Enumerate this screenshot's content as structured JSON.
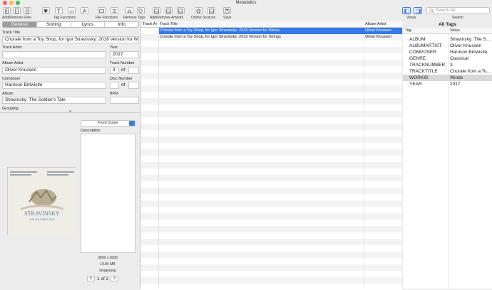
{
  "window": {
    "title": "Metadatics"
  },
  "toolbar": {
    "groups": [
      {
        "label": "Add/Remove Files"
      },
      {
        "label": "Tag Functions"
      },
      {
        "label": "File Functions"
      },
      {
        "label": "Remove Tags"
      },
      {
        "label": "Add/Remove Artwork"
      },
      {
        "label": "Online Sources"
      },
      {
        "label": "Save"
      },
      {
        "label": "Views"
      },
      {
        "label": "Search"
      }
    ],
    "search_placeholder": "Search All"
  },
  "left": {
    "tabs": [
      {
        "label": "General",
        "active": true
      },
      {
        "label": "Sorting",
        "active": false
      },
      {
        "label": "Lyrics",
        "active": false
      },
      {
        "label": "Info",
        "active": false
      }
    ],
    "fields": {
      "track_title_label": "Track Title",
      "track_title": "Chorale from a Toy Shop, for Igor Stravinsky: 2016 Version for W",
      "track_artist_label": "Track Artist",
      "track_artist": "",
      "year_label": "Year",
      "year": "2017",
      "album_artist_label": "Album Artist",
      "album_artist": "Oliver Knussen",
      "track_number_label": "Track Number",
      "track_number": "3",
      "track_of": "of",
      "composer_label": "Composer",
      "composer": "Harrison Birtwistle",
      "disc_number_label": "Disc Number",
      "disc_of": "of",
      "album_label": "Album",
      "album": "Stravinsky: The Soldier's Tale",
      "bpm_label": "BPM",
      "grouping_label": "Grouping",
      "description_label": "Description"
    },
    "artwork": {
      "cover_type": "Front Cover",
      "dimensions": "3000 x 3000",
      "size": "19.84 MB",
      "format": "image/png",
      "page": "1 of 2",
      "prev": "<",
      "next": ">",
      "cover_title": "STRAVINSKY",
      "cover_subtitle": "THE SOLDIER'S TALE"
    }
  },
  "table": {
    "columns": [
      "Track Ar",
      "Track Title",
      "Album Artist"
    ],
    "rows": [
      {
        "track_artist": "",
        "title": "Chorale from a Toy Shop, for Igor Stravinsky: 2016 Version for Winds",
        "album_artist": "Oliver Knussen",
        "selected": true
      },
      {
        "track_artist": "",
        "title": "Chorale from a Toy Shop, for Igor Stravinsky: 2016 Version for Strings",
        "album_artist": "Oliver Knussen",
        "selected": false
      }
    ]
  },
  "tags": {
    "title": "All Tags",
    "col_tag": "Tag",
    "col_value": "Value",
    "rows": [
      {
        "tag": "ALBUM",
        "value": "Stravinsky: The So..."
      },
      {
        "tag": "ALBUMARTIST",
        "value": "Oliver Knussen"
      },
      {
        "tag": "COMPOSER",
        "value": "Harrison Birtwistle"
      },
      {
        "tag": "GENRE",
        "value": "Classical"
      },
      {
        "tag": "TRACKNUMBER",
        "value": "3"
      },
      {
        "tag": "TRACKTITLE",
        "value": "Chorale from a To..."
      },
      {
        "tag": "WORKID",
        "value": "Winds"
      },
      {
        "tag": "YEAR",
        "value": "2017"
      }
    ]
  },
  "colors": {
    "selection": "#3677ea",
    "close": "#fc605c",
    "minimize": "#fdbc40",
    "zoom": "#34c84a"
  }
}
